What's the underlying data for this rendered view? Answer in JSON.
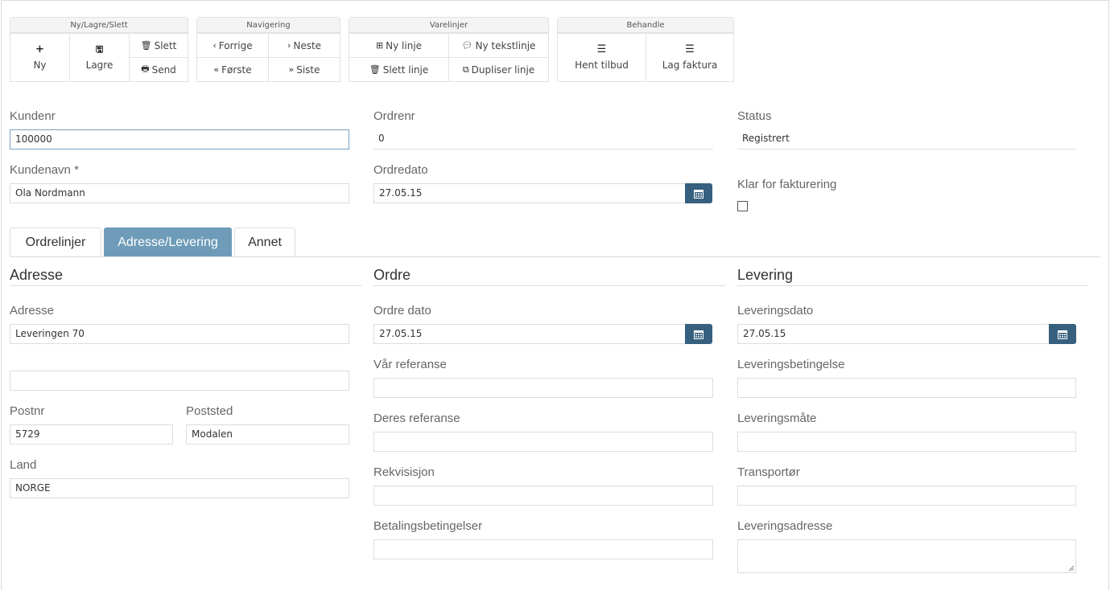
{
  "toolbar": {
    "group1": {
      "title": "Ny/Lagre/Slett",
      "new": "Ny",
      "save": "Lagre",
      "delete": "Slett",
      "send": "Send"
    },
    "group2": {
      "title": "Navigering",
      "prev": "Forrige",
      "next": "Neste",
      "first": "Første",
      "last": "Siste"
    },
    "group3": {
      "title": "Varelinjer",
      "new_line": "Ny linje",
      "new_text_line": "Ny tekstlinje",
      "delete_line": "Slett linje",
      "duplicate_line": "Dupliser linje"
    },
    "group4": {
      "title": "Behandle",
      "get_offer": "Hent tilbud",
      "make_invoice": "Lag faktura"
    }
  },
  "header": {
    "customer_no_label": "Kundenr",
    "customer_no": "100000",
    "customer_name_label": "Kundenavn *",
    "customer_name": "Ola Nordmann",
    "order_no_label": "Ordrenr",
    "order_no": "0",
    "order_date_label": "Ordredato",
    "order_date": "27.05.15",
    "status_label": "Status",
    "status": "Registrert",
    "ready_label": "Klar for fakturering",
    "ready_checked": false
  },
  "tabs": [
    "Ordrelinjer",
    "Adresse/Levering",
    "Annet"
  ],
  "active_tab": "Adresse/Levering",
  "address": {
    "title": "Adresse",
    "address_label": "Adresse",
    "address1": "Leveringen 70",
    "address2": "",
    "postnr_label": "Postnr",
    "postnr": "5729",
    "poststed_label": "Poststed",
    "poststed": "Modalen",
    "country_label": "Land",
    "country": "NORGE"
  },
  "order": {
    "title": "Ordre",
    "date_label": "Ordre dato",
    "date": "27.05.15",
    "our_ref_label": "Vår referanse",
    "our_ref": "",
    "their_ref_label": "Deres referanse",
    "their_ref": "",
    "requisition_label": "Rekvisisjon",
    "requisition": "",
    "payment_terms_label": "Betalingsbetingelser",
    "payment_terms": ""
  },
  "delivery": {
    "title": "Levering",
    "date_label": "Leveringsdato",
    "date": "27.05.15",
    "terms_label": "Leveringsbetingelse",
    "terms": "",
    "method_label": "Leveringsmåte",
    "method": "",
    "carrier_label": "Transportør",
    "carrier": "",
    "address_label": "Leveringsadresse",
    "address": ""
  },
  "colors": {
    "accent": "#36607e",
    "tab_active": "#6e9cb8"
  }
}
